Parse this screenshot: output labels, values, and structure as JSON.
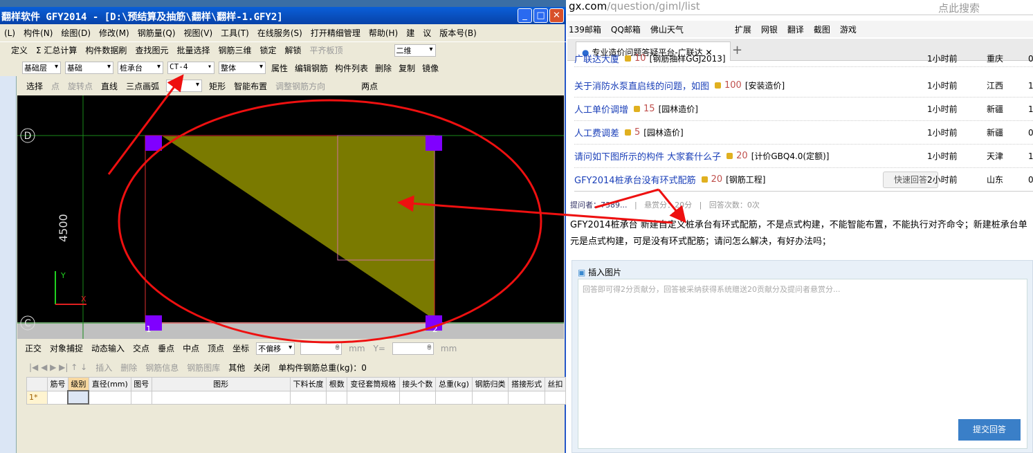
{
  "app": {
    "title": "翻样软件 GFY2014 - [D:\\预结算及抽筋\\翻样\\翻样-1.GFY2]",
    "menu": [
      "(L)",
      "构件(N)",
      "绘图(D)",
      "修改(M)",
      "钢筋量(Q)",
      "视图(V)",
      "工具(T)",
      "在线服务(S)",
      "打开精细管理",
      "帮助(H)",
      "建",
      "议",
      "版本号(B)"
    ],
    "toolbar1": [
      "定义",
      "Σ 汇总计算",
      "构件数据刷",
      "查找图元",
      "批量选择",
      "钢筋三维",
      "锁定",
      "解锁",
      "平齐板顶"
    ],
    "view_mode": "二维",
    "toolbar2": {
      "floor": "基础层",
      "category": "基础",
      "type": "桩承台",
      "component": "CT-4",
      "scope": "整体",
      "buttons": [
        "属性",
        "编辑钢筋",
        "构件列表",
        "删除",
        "复制",
        "镜像"
      ]
    },
    "toolbar3": [
      "选择",
      "点",
      "旋转点",
      "直线",
      "三点画弧",
      "矩形",
      "智能布置",
      "调整钢筋方向",
      "两点"
    ],
    "canvas": {
      "axis_d": "D",
      "axis_c": "C",
      "dimension": "4500",
      "y_label": "Y",
      "x_label": "X",
      "corner_1": "1",
      "corner_2": "2"
    },
    "snap_bar": [
      "正交",
      "对象捕捉",
      "动态输入",
      "交点",
      "垂点",
      "中点",
      "顶点",
      "坐标"
    ],
    "offset_mode": "不偏移",
    "x_value": "0",
    "y_value": "0",
    "unit": "mm",
    "y_label": "Y=",
    "rebar_bar": [
      "插入",
      "删除",
      "钢筋信息",
      "钢筋图库",
      "其他",
      "关闭"
    ],
    "total_weight": "单构件钢筋总重(kg)：0",
    "table": {
      "headers": [
        "筋号",
        "级别",
        "直径(mm)",
        "图号",
        "图形",
        "下料长度",
        "根数",
        "变径套筒规格",
        "接头个数",
        "总重(kg)",
        "钢筋归类",
        "搭接形式",
        "丝扣"
      ],
      "row_label": "1*"
    }
  },
  "browser": {
    "url_host": "gx.com",
    "url_path": "/question/giml/list",
    "search_placeholder": "点此搜索",
    "bookmarks": [
      "139邮箱",
      "QQ邮箱",
      "佛山天气",
      "扩展",
      "网银",
      "翻译",
      "截图",
      "游戏"
    ],
    "tab_title": "专业造价问题答疑平台-广联达",
    "new_tab": "+",
    "questions": [
      {
        "title": "广联达大厦",
        "points": "10",
        "tag": "[钢筋抽样GGJ2013]",
        "time": "1小时前",
        "province": "重庆",
        "extra": "0"
      },
      {
        "title": "关于消防水泵直启线的问题，如图",
        "points": "100",
        "tag": "[安装造价]",
        "time": "1小时前",
        "province": "江西",
        "extra": "1"
      },
      {
        "title": "人工单价调增",
        "points": "15",
        "tag": "[园林造价]",
        "time": "1小时前",
        "province": "新疆",
        "extra": "1"
      },
      {
        "title": "人工费调差",
        "points": "5",
        "tag": "[园林造价]",
        "time": "1小时前",
        "province": "新疆",
        "extra": "0"
      },
      {
        "title": "请问如下图所示的构件 大家套什么子",
        "points": "20",
        "tag": "[计价GBQ4.0(定额)]",
        "time": "1小时前",
        "province": "天津",
        "extra": "1"
      },
      {
        "title": "GFY2014桩承台没有环式配筋",
        "points": "20",
        "tag": "[钢筋工程]",
        "time": "2小时前",
        "province": "山东",
        "extra": "0",
        "quick": "快速回答"
      }
    ],
    "meta": {
      "asker": "提问者：7389...",
      "reward": "悬赏分：20分",
      "answers": "回答次数：0次"
    },
    "body": "GFY2014桩承台 新建自定义桩承台有环式配筋，不是点式构建，不能智能布置，不能执行对齐命令；新建桩承台单元是点式构建，可是没有环式配筋；请问怎么解决，有好办法吗；",
    "insert_image": "插入图片",
    "answer_placeholder": "回答即可得2分贡献分，回答被采纳获得系统赠送20贡献分及提问者悬赏分...",
    "submit": "提交回答"
  }
}
